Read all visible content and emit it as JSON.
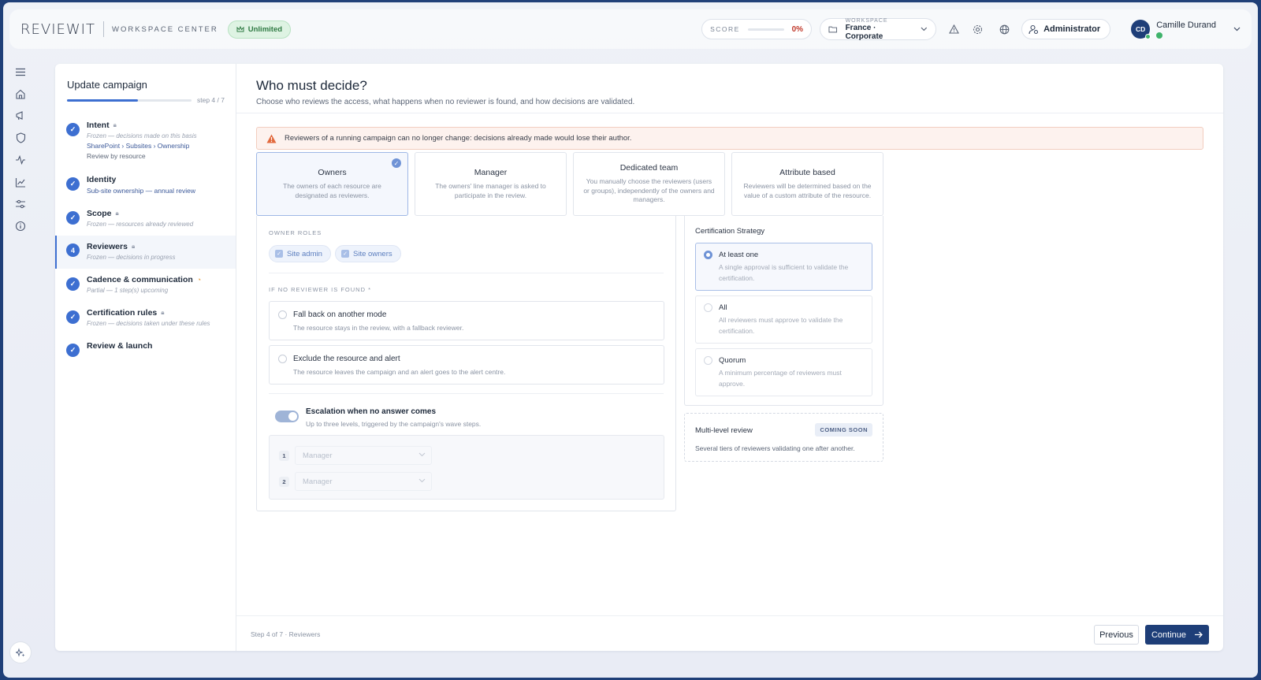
{
  "app": {
    "logo": "REVIEWIT",
    "section": "WORKSPACE CENTER",
    "plan_badge": "Unlimited"
  },
  "topbar": {
    "score_label": "SCORE",
    "score_value": "0%",
    "score_fraction": 0,
    "workspace_label": "WORKSPACE",
    "workspace_name": "France · Corporate",
    "admin_label": "Administrator",
    "user_initials": "CD",
    "user_name": "Camille Durand"
  },
  "stepper": {
    "title": "Update campaign",
    "count": "step 4 / 7",
    "progress_fraction": 0.57,
    "steps": [
      {
        "num": "",
        "name": "Intent",
        "locked": true,
        "sub": "Frozen — decisions made on this basis",
        "sub2": "SharePoint › Subsites › Ownership",
        "sub3": "Review by resource"
      },
      {
        "num": "",
        "name": "Identity",
        "sub2": "Sub-site ownership — annual review"
      },
      {
        "num": "",
        "name": "Scope",
        "locked": true,
        "sub": "Frozen — resources already reviewed"
      },
      {
        "num": "4",
        "name": "Reviewers",
        "locked": true,
        "sub": "Frozen — decisions in progress"
      },
      {
        "num": "",
        "name": "Cadence & communication",
        "partial": true,
        "sub": "Partial — 1 step(s) upcoming"
      },
      {
        "num": "",
        "name": "Certification rules",
        "locked": true,
        "sub": "Frozen — decisions taken under these rules"
      },
      {
        "num": "",
        "name": "Review & launch"
      }
    ]
  },
  "main": {
    "title": "Who must decide?",
    "subtitle": "Choose who reviews the access, what happens when no reviewer is found, and how decisions are validated.",
    "alert": "Reviewers of a running campaign can no longer change: decisions already made would lose their author.",
    "modes": [
      {
        "title": "Owners",
        "desc": "The owners of each resource are designated as reviewers."
      },
      {
        "title": "Manager",
        "desc": "The owners' line manager is asked to participate in the review."
      },
      {
        "title": "Dedicated team",
        "desc": "You manually choose the reviewers (users or groups), independently of the owners and managers."
      },
      {
        "title": "Attribute based",
        "desc": "Reviewers will be determined based on the value of a custom attribute of the resource."
      }
    ],
    "owner_roles_label": "OWNER ROLES",
    "owner_roles": [
      "Site admin",
      "Site owners"
    ],
    "no_reviewer_label": "IF NO REVIEWER IS FOUND *",
    "no_reviewer_options": [
      {
        "title": "Fall back on another mode",
        "desc": "The resource stays in the review, with a fallback reviewer."
      },
      {
        "title": "Exclude the resource and alert",
        "desc": "The resource leaves the campaign and an alert goes to the alert centre."
      }
    ],
    "escalation_title": "Escalation when no answer comes",
    "escalation_desc": "Up to three levels, triggered by the campaign's wave steps.",
    "escalation_levels": [
      {
        "num": "1",
        "value": "Manager"
      },
      {
        "num": "2",
        "value": "Manager"
      }
    ],
    "strategy_title": "Certification Strategy",
    "strategies": [
      {
        "name": "At least one",
        "desc": "A single approval is sufficient to validate the certification."
      },
      {
        "name": "All",
        "desc": "All reviewers must approve to validate the certification."
      },
      {
        "name": "Quorum",
        "desc": "A minimum percentage of reviewers must approve."
      }
    ],
    "multi_title": "Multi-level review",
    "multi_badge": "COMING SOON",
    "multi_desc": "Several tiers of reviewers validating one after another."
  },
  "footer": {
    "step_text": "Step 4 of 7 · Reviewers",
    "previous": "Previous",
    "continue": "Continue"
  }
}
